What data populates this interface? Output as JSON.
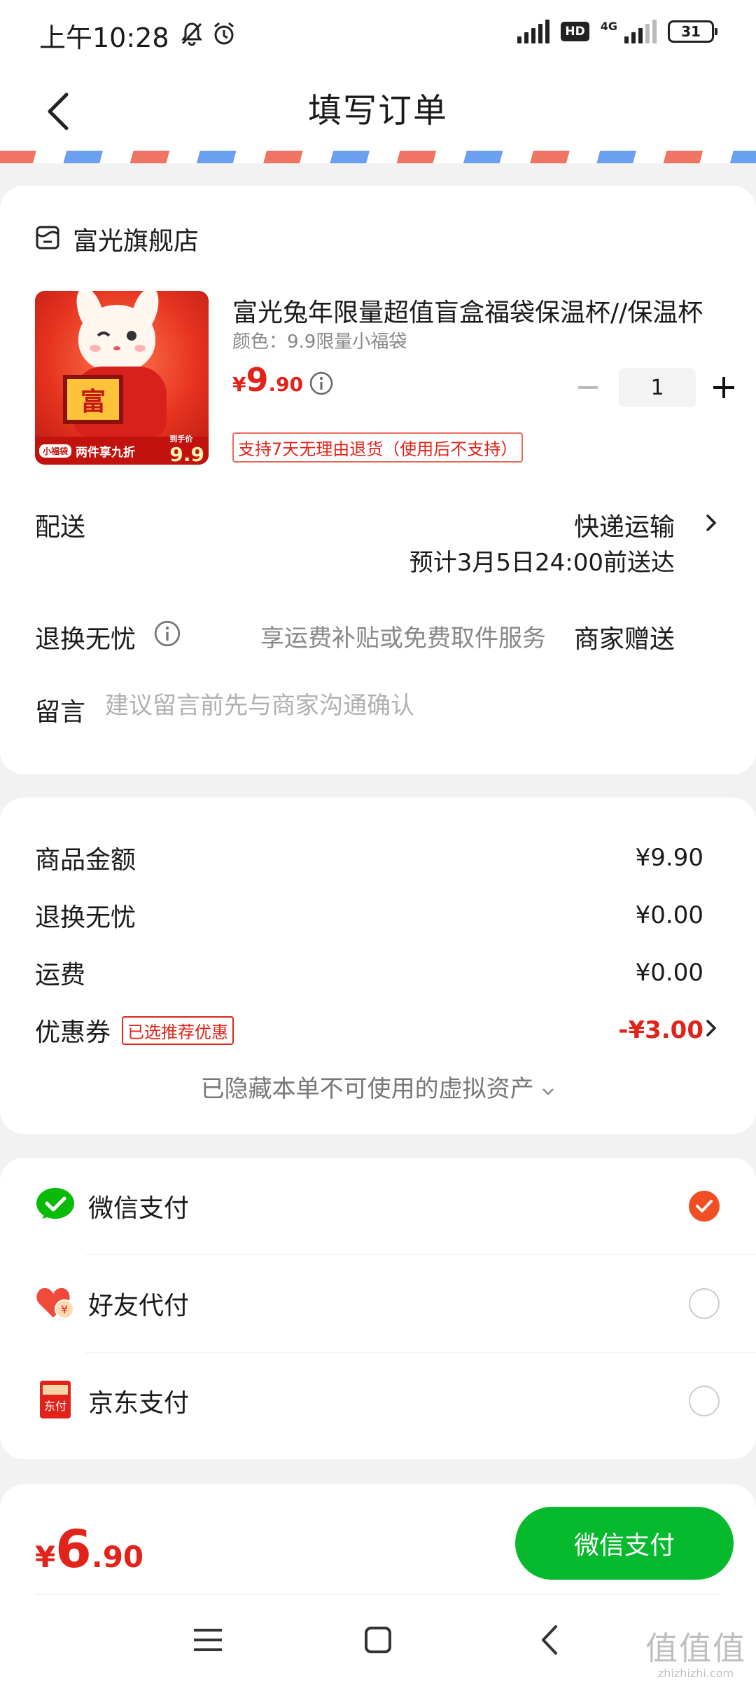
{
  "status_bar": {
    "time": "上午10:28",
    "network": "4G",
    "battery": "31"
  },
  "header": {
    "title": "填写订单"
  },
  "shop": {
    "name": "富光旗舰店"
  },
  "product": {
    "title": "富光兔年限量超值盲盒福袋保温杯//保温杯",
    "spec": "颜色：9.9限量小福袋",
    "price_currency": "¥",
    "price_int": "9",
    "price_dec": ".90",
    "quantity": "1",
    "return_policy": "支持7天无理由退货（使用后不支持）",
    "image": {
      "sign_text": "富",
      "tag": "小福袋",
      "promo": "两件享九折",
      "price_caption": "到手价",
      "price": "9.9"
    }
  },
  "delivery": {
    "label": "配送",
    "method": "快递运输",
    "estimate": "预计3月5日24:00前送达"
  },
  "worry_free": {
    "label": "退换无忧",
    "desc": "享运费补贴或免费取件服务",
    "value": "商家赠送"
  },
  "message": {
    "label": "留言",
    "placeholder": "建议留言前先与商家沟通确认"
  },
  "price_summary": {
    "goods_label": "商品金额",
    "goods_amount": "¥9.90",
    "worry_label": "退换无忧",
    "worry_amount": "¥0.00",
    "shipping_label": "运费",
    "shipping_amount": "¥0.00",
    "coupon_label": "优惠券",
    "coupon_tag": "已选推荐优惠",
    "coupon_amount": "-¥3.00",
    "hidden_assets": "已隐藏本单不可使用的虚拟资产"
  },
  "payment_methods": [
    {
      "label": "微信支付",
      "icon": "wechat-pay-icon",
      "selected": true
    },
    {
      "label": "好友代付",
      "icon": "friend-pay-icon",
      "selected": false
    },
    {
      "label": "京东支付",
      "icon": "jd-pay-icon",
      "selected": false
    }
  ],
  "footer": {
    "currency": "¥",
    "total_int": "6",
    "total_dec": ".90",
    "pay_button": "微信支付"
  },
  "watermark": {
    "big": "值值值",
    "small": "zhizhizhi.com"
  },
  "colors": {
    "accent_red": "#e2231a",
    "wechat_green": "#07b92d",
    "check_orange": "#f04e23"
  }
}
